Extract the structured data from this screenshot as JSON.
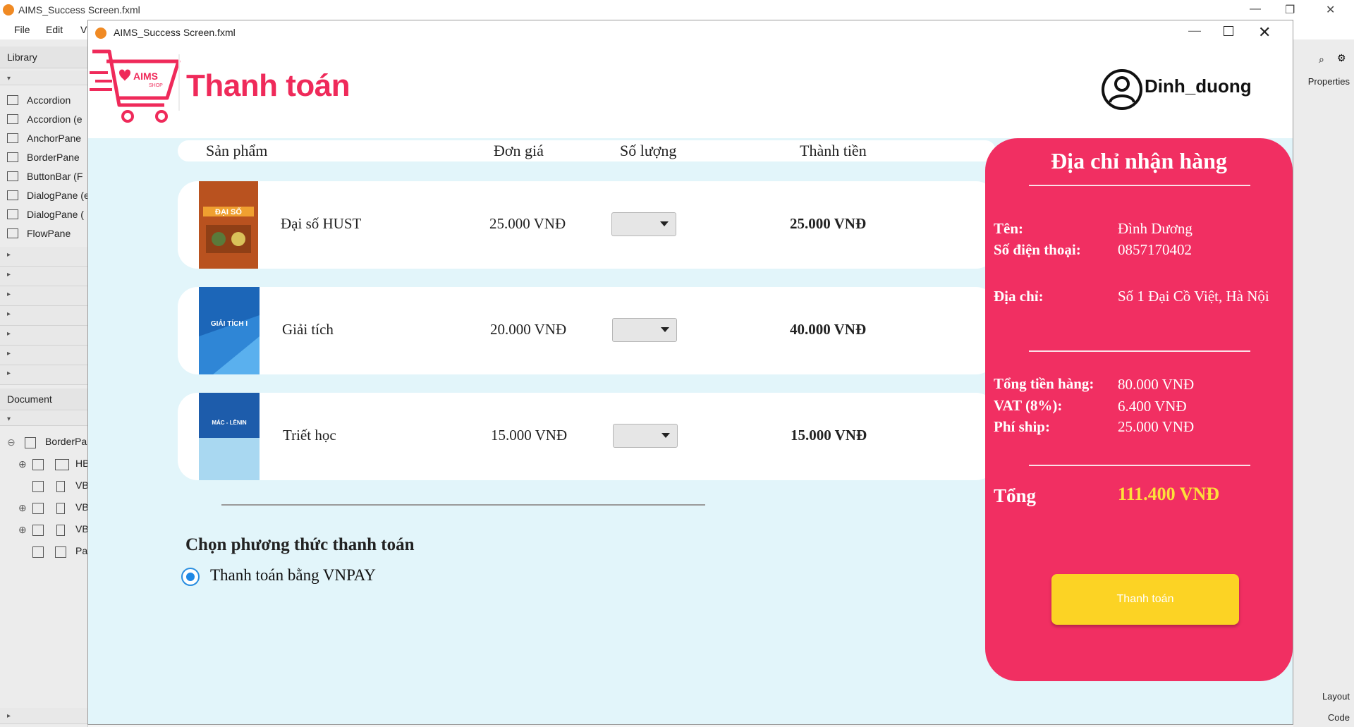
{
  "bg_window": {
    "title": "AIMS_Success Screen.fxml",
    "menu": [
      "File",
      "Edit",
      "V"
    ],
    "library_label": "Library",
    "library_items": [
      "Accordion",
      "Accordion  (e",
      "AnchorPane",
      "BorderPane",
      "ButtonBar  (F",
      "DialogPane (e",
      "DialogPane  (",
      "FlowPane"
    ],
    "document_label": "Document",
    "tree_items": [
      "BorderPa",
      "HB",
      "VB",
      "VB",
      "VB",
      "Pa"
    ],
    "right_tabs": {
      "properties": "Properties",
      "layout": "Layout",
      "code": "Code"
    }
  },
  "app": {
    "window_title": "AIMS_Success Screen.fxml",
    "logo_text": "AIMS",
    "logo_sub": "SHOP",
    "page_title": "Thanh toán",
    "username": "Dinh_duong"
  },
  "table": {
    "headers": {
      "product": "Sản phẩm",
      "unit_price": "Đơn giá",
      "quantity": "Số lượng",
      "subtotal": "Thành tiền"
    },
    "rows": [
      {
        "name": "Đại số HUST",
        "unit_price": "25.000 VNĐ",
        "subtotal": "25.000 VNĐ",
        "cover_title": "ĐẠI SỐ",
        "cover_color": "#b24a1e"
      },
      {
        "name": "Giải tích",
        "unit_price": "20.000 VNĐ",
        "subtotal": "40.000 VNĐ",
        "cover_title": "GIẢI TÍCH I",
        "cover_color": "#1a63b8"
      },
      {
        "name": "Triết học",
        "unit_price": "15.000 VNĐ",
        "subtotal": "15.000 VNĐ",
        "cover_title": "MÁC - LÊNIN",
        "cover_color": "#1d5cab"
      }
    ]
  },
  "payment": {
    "title": "Chọn phương thức thanh toán",
    "option": "Thanh toán bằng VNPAY"
  },
  "summary": {
    "title": "Địa chỉ nhận hàng",
    "name_label": "Tên:",
    "name_value": "Đình Dương",
    "phone_label": "Số điện thoại:",
    "phone_value": "0857170402",
    "address_label": "Địa chỉ:",
    "address_value": "Số 1 Đại Cồ Việt, Hà Nội",
    "goods_label": "Tổng tiền hàng:",
    "goods_value": "80.000 VNĐ",
    "vat_label": "VAT (8%):",
    "vat_value": "6.400 VNĐ",
    "ship_label": "Phí ship:",
    "ship_value": "25.000 VNĐ",
    "total_label": "Tổng",
    "total_value": "111.400 VNĐ",
    "pay_button": "Thanh toán"
  },
  "colors": {
    "brand": "#ef2a5a",
    "summary_bg": "#f12f62",
    "button": "#fcd324",
    "total": "#fde03a",
    "content_bg": "#e2f5fa"
  }
}
